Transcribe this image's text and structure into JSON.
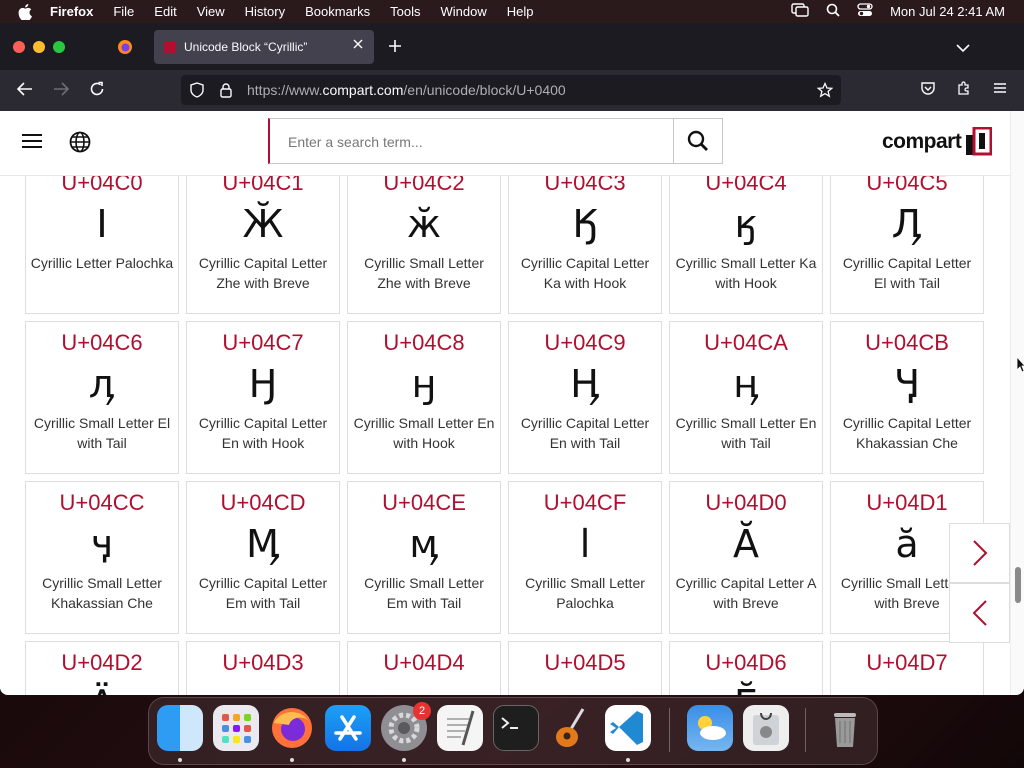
{
  "menubar": {
    "app_name": "Firefox",
    "items": [
      "File",
      "Edit",
      "View",
      "History",
      "Bookmarks",
      "Tools",
      "Window",
      "Help"
    ],
    "clock": "Mon Jul 24  2:41 AM"
  },
  "browser": {
    "tab_title": "Unicode Block “Cyrillic”",
    "url_prefix": "https://www.",
    "url_domain": "compart.com",
    "url_path": "/en/unicode/block/U+0400"
  },
  "site": {
    "search_placeholder": "Enter a search term...",
    "logo_text": "compart"
  },
  "characters": [
    {
      "code": "U+04C0",
      "glyph": "Ӏ",
      "name": "Cyrillic Letter Palochka"
    },
    {
      "code": "U+04C1",
      "glyph": "Ӂ",
      "name": "Cyrillic Capital Letter Zhe with Breve"
    },
    {
      "code": "U+04C2",
      "glyph": "ӂ",
      "name": "Cyrillic Small Letter Zhe with Breve"
    },
    {
      "code": "U+04C3",
      "glyph": "Ӄ",
      "name": "Cyrillic Capital Letter Ka with Hook"
    },
    {
      "code": "U+04C4",
      "glyph": "ӄ",
      "name": "Cyrillic Small Letter Ka with Hook"
    },
    {
      "code": "U+04C5",
      "glyph": "Ӆ",
      "name": "Cyrillic Capital Letter El with Tail"
    },
    {
      "code": "U+04C6",
      "glyph": "ӆ",
      "name": "Cyrillic Small Letter El with Tail"
    },
    {
      "code": "U+04C7",
      "glyph": "Ӈ",
      "name": "Cyrillic Capital Letter En with Hook"
    },
    {
      "code": "U+04C8",
      "glyph": "ӈ",
      "name": "Cyrillic Small Letter En with Hook"
    },
    {
      "code": "U+04C9",
      "glyph": "Ӊ",
      "name": "Cyrillic Capital Letter En with Tail"
    },
    {
      "code": "U+04CA",
      "glyph": "ӊ",
      "name": "Cyrillic Small Letter En with Tail"
    },
    {
      "code": "U+04CB",
      "glyph": "Ӌ",
      "name": "Cyrillic Capital Letter Khakassian Che"
    },
    {
      "code": "U+04CC",
      "glyph": "ӌ",
      "name": "Cyrillic Small Letter Khakassian Che"
    },
    {
      "code": "U+04CD",
      "glyph": "Ӎ",
      "name": "Cyrillic Capital Letter Em with Tail"
    },
    {
      "code": "U+04CE",
      "glyph": "ӎ",
      "name": "Cyrillic Small Letter Em with Tail"
    },
    {
      "code": "U+04CF",
      "glyph": "ӏ",
      "name": "Cyrillic Small Letter Palochka"
    },
    {
      "code": "U+04D0",
      "glyph": "Ӑ",
      "name": "Cyrillic Capital Letter A with Breve"
    },
    {
      "code": "U+04D1",
      "glyph": "ӑ",
      "name": "Cyrillic Small Letter A with Breve"
    },
    {
      "code": "U+04D2",
      "glyph": "Ӓ",
      "name": ""
    },
    {
      "code": "U+04D3",
      "glyph": "",
      "name": ""
    },
    {
      "code": "U+04D4",
      "glyph": "",
      "name": ""
    },
    {
      "code": "U+04D5",
      "glyph": "",
      "name": ""
    },
    {
      "code": "U+04D6",
      "glyph": "Ӗ",
      "name": ""
    },
    {
      "code": "U+04D7",
      "glyph": "",
      "name": ""
    }
  ],
  "colors": {
    "accent": "#b01030"
  },
  "dock": {
    "badge_count": "2",
    "apps": [
      "finder-icon",
      "launchpad-icon",
      "firefox-icon",
      "app-store-icon",
      "system-settings-icon",
      "textedit-icon",
      "terminal-icon",
      "garageband-icon",
      "vscode-icon",
      "weather-icon",
      "disk-utility-icon",
      "trash-icon"
    ]
  }
}
